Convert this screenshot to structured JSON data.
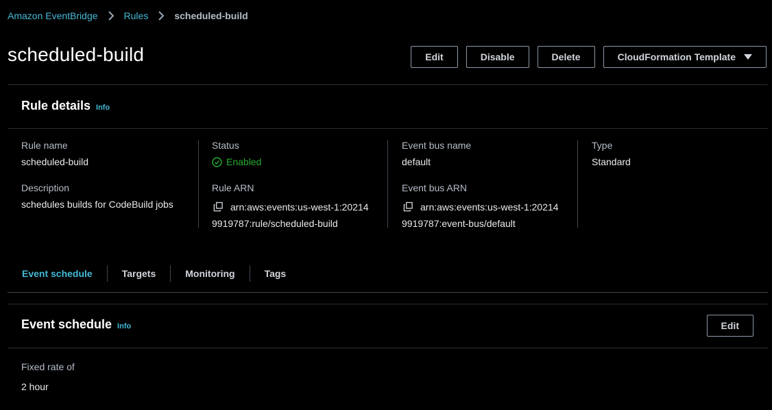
{
  "breadcrumb": {
    "items": [
      "Amazon EventBridge",
      "Rules"
    ],
    "current": "scheduled-build"
  },
  "page": {
    "title": "scheduled-build"
  },
  "actions": {
    "edit": "Edit",
    "disable": "Disable",
    "delete": "Delete",
    "cloudformation": "CloudFormation Template"
  },
  "rule_details": {
    "title": "Rule details",
    "info": "Info",
    "rule_name_label": "Rule name",
    "rule_name": "scheduled-build",
    "description_label": "Description",
    "description": "schedules builds for CodeBuild jobs",
    "status_label": "Status",
    "status": "Enabled",
    "rule_arn_label": "Rule ARN",
    "rule_arn_line1": "arn:aws:events:us-west-1:20214",
    "rule_arn_line2": "9919787:rule/scheduled-build",
    "event_bus_name_label": "Event bus name",
    "event_bus_name": "default",
    "event_bus_arn_label": "Event bus ARN",
    "event_bus_arn_line1": "arn:aws:events:us-west-1:20214",
    "event_bus_arn_line2": "9919787:event-bus/default",
    "type_label": "Type",
    "type": "Standard"
  },
  "tabs": [
    "Event schedule",
    "Targets",
    "Monitoring",
    "Tags"
  ],
  "active_tab": "Event schedule",
  "event_schedule": {
    "title": "Event schedule",
    "info": "Info",
    "edit": "Edit",
    "fixed_rate_label": "Fixed rate of",
    "fixed_rate_value": "2 hour"
  },
  "colors": {
    "background": "#000000",
    "link": "#44b9d6",
    "success": "#29ad32",
    "border": "#8d99a8"
  },
  "icons": {
    "breadcrumb_separator": "chevron-right-icon",
    "status": "check-circle-icon",
    "copy": "copy-icon",
    "dropdown": "caret-down-icon"
  }
}
